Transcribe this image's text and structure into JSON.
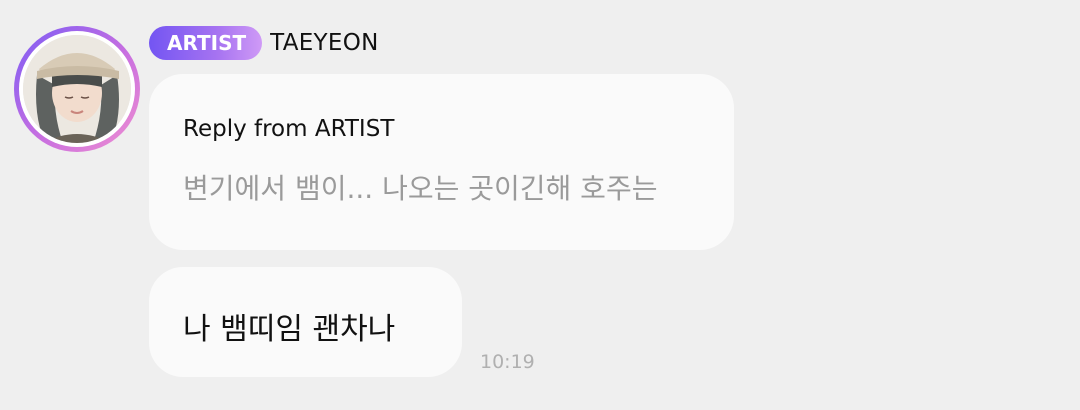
{
  "sender": {
    "badge": "ARTIST",
    "name": "TAEYEON"
  },
  "reply": {
    "label": "Reply from ARTIST",
    "quoted_text": "변기에서 뱀이... 나오는 곳이긴해 호주는"
  },
  "message": {
    "text": "나 뱀띠임 괜차나",
    "time": "10:19"
  },
  "colors": {
    "background": "#efefef",
    "bubble": "#fafafa",
    "badge_gradient_start": "#7355f2",
    "badge_gradient_end": "#cf9af6",
    "muted_text": "#9a9a9a"
  }
}
